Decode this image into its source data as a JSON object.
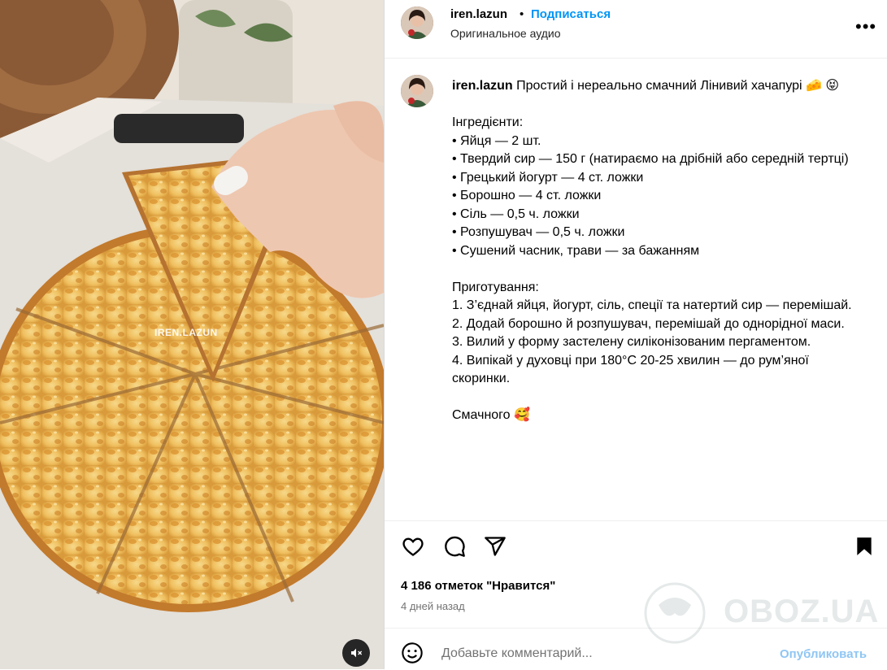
{
  "post": {
    "username": "iren.lazun",
    "follow_label": "Подписаться",
    "separator": "•",
    "audio_label": "Оригинальное аудио",
    "more_label": "•••",
    "media_watermark": "IREN.LAZUN"
  },
  "caption": {
    "username": "iren.lazun",
    "first_line": "Простий і нереально смачний Лінивий хачапурі 🧀 😝",
    "lines": [
      "",
      "Інгредієнти:",
      "• Яйця — 2 шт.",
      "• Твердий сир — 150 г (натираємо на дрібній або середній тертці)",
      "• Грецький йогурт — 4 ст. ложки",
      "• Борошно — 4 ст. ложки",
      "• Сіль — 0,5 ч. ложки",
      "• Розпушувач — 0,5 ч. ложки",
      "• Сушений часник, трави — за бажанням",
      "",
      "Приготування:",
      "1. З’єднай яйця, йогурт, сіль, спеції та натертий сир — перемішай.",
      "2. Додай борошно й розпушувач, перемішай до однорідної маси.",
      "3. Вилий у форму застелену силіконізованим пергаментом.",
      "4. Випікай у духовці при 180°C 20-25 хвилин — до рум’яної скоринки.",
      "",
      "Смачного 🥰"
    ]
  },
  "stats": {
    "likes": "4 186 отметок \"Нравится\"",
    "time_ago": "4 дней назад"
  },
  "comment": {
    "placeholder": "Добавьте комментарий...",
    "publish_label": "Опубликовать"
  },
  "watermark": {
    "site": "OBOZ.UA"
  },
  "colors": {
    "accent": "#0095f6",
    "publish_disabled": "#8fc6f4",
    "muted_text": "#737373"
  }
}
